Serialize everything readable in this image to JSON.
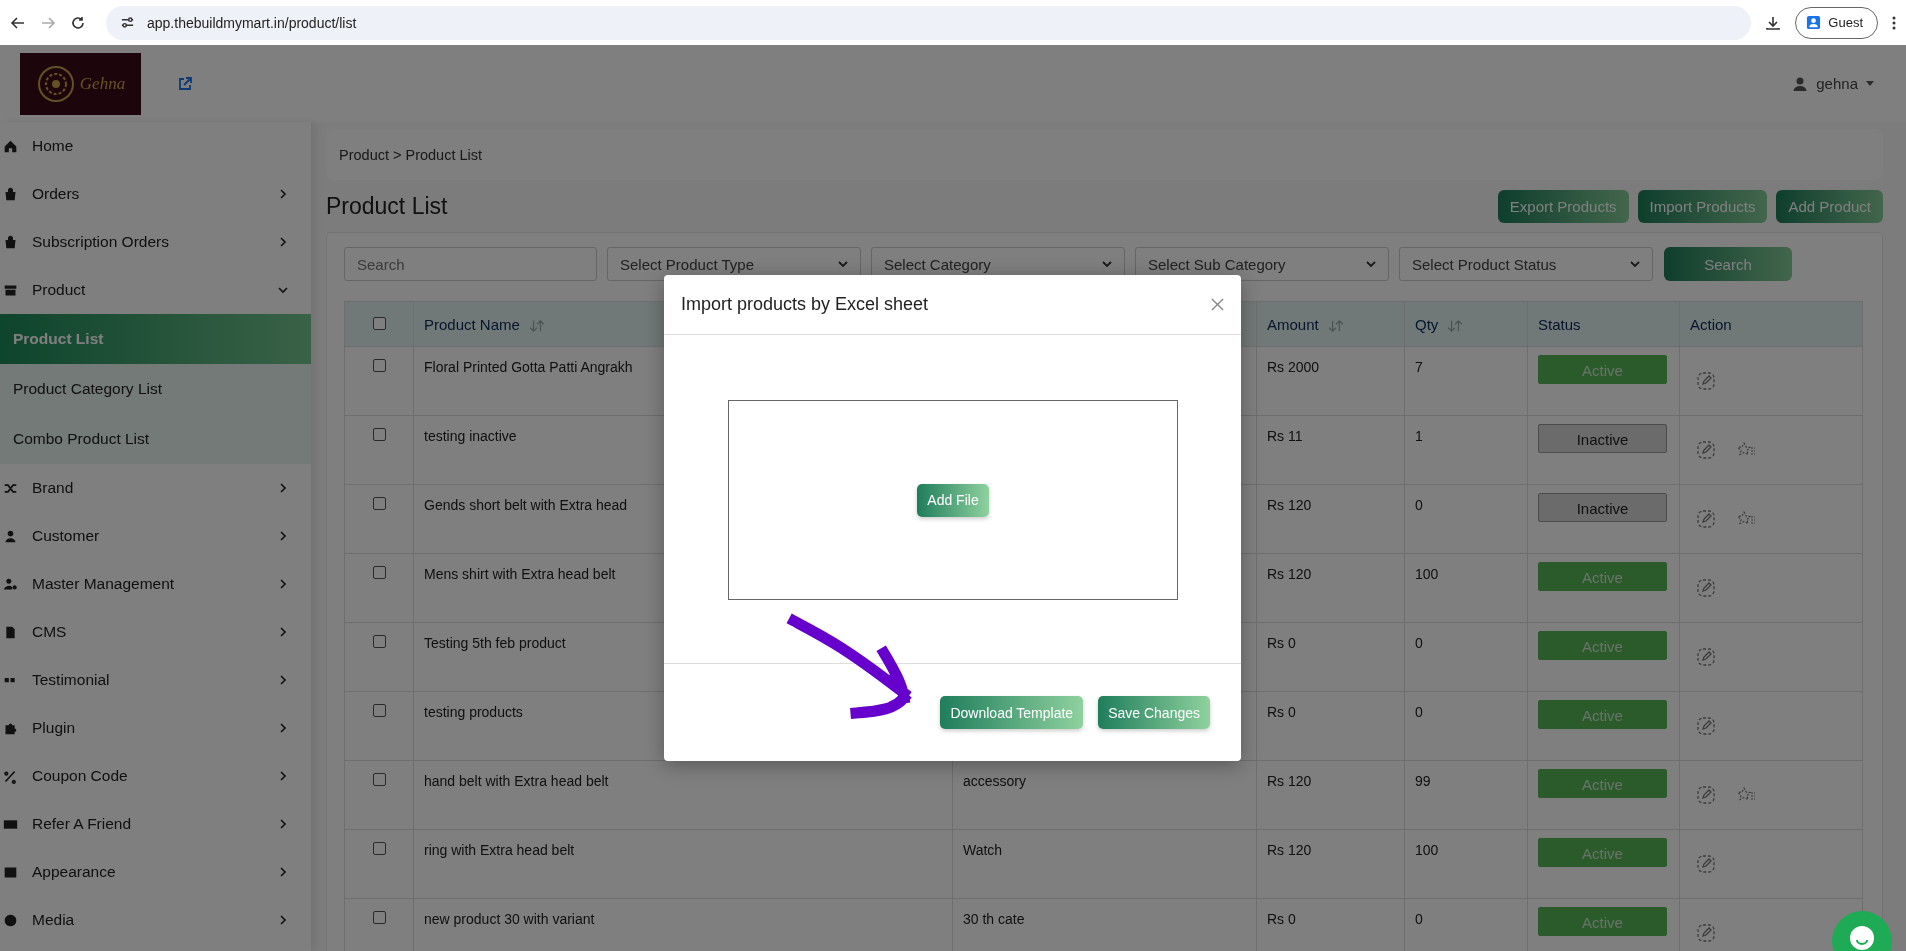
{
  "browser": {
    "url": "app.thebuildmymart.in/product/list",
    "profile": "Guest"
  },
  "header": {
    "logo_text": "Gehna",
    "user": "gehna"
  },
  "sidebar": {
    "items": [
      {
        "label": "Home",
        "kind": "link",
        "selected": false
      },
      {
        "label": "Orders",
        "kind": "group",
        "selected": false,
        "expanded": false
      },
      {
        "label": "Subscription Orders",
        "kind": "group",
        "selected": false,
        "expanded": false
      },
      {
        "label": "Product",
        "kind": "group",
        "selected": false,
        "expanded": true,
        "children": [
          {
            "label": "Product List",
            "selected": true
          },
          {
            "label": "Product Category List",
            "selected": false
          },
          {
            "label": "Combo Product List",
            "selected": false
          }
        ]
      },
      {
        "label": "Brand",
        "kind": "group",
        "selected": false,
        "expanded": false
      },
      {
        "label": "Customer",
        "kind": "group",
        "selected": false,
        "expanded": false
      },
      {
        "label": "Master Management",
        "kind": "group",
        "selected": false,
        "expanded": false
      },
      {
        "label": "CMS",
        "kind": "group",
        "selected": false,
        "expanded": false
      },
      {
        "label": "Testimonial",
        "kind": "group",
        "selected": false,
        "expanded": false
      },
      {
        "label": "Plugin",
        "kind": "group",
        "selected": false,
        "expanded": false
      },
      {
        "label": "Coupon Code",
        "kind": "group",
        "selected": false,
        "expanded": false
      },
      {
        "label": "Refer A Friend",
        "kind": "group",
        "selected": false,
        "expanded": false
      },
      {
        "label": "Appearance",
        "kind": "group",
        "selected": false,
        "expanded": false
      },
      {
        "label": "Media",
        "kind": "group",
        "selected": false,
        "expanded": false
      }
    ]
  },
  "breadcrumb": "Product > Product List",
  "page_title": "Product List",
  "actions": [
    "Export Products",
    "Import Products",
    "Add Product"
  ],
  "filters": {
    "search_placeholder": "Search",
    "selects": [
      "Select Product Type",
      "Select Category",
      "Select Sub Category",
      "Select Product Status"
    ],
    "button": "Search"
  },
  "table": {
    "select_all_checked": false,
    "columns": [
      {
        "label": "Product Name",
        "sortable": true
      },
      {
        "label": "Amount",
        "sortable": true
      },
      {
        "label": "Qty",
        "sortable": true
      },
      {
        "label": "Status",
        "sortable": false
      },
      {
        "label": "Action",
        "sortable": false
      }
    ],
    "rows": [
      {
        "checked": false,
        "name": "Floral Printed Gotta Patti Angrakh",
        "amount": "Rs 2000",
        "qty": "7",
        "status": "Active",
        "active": true,
        "extra_action": false
      },
      {
        "checked": false,
        "name": "testing inactive",
        "amount": "Rs 11",
        "qty": "1",
        "status": "Inactive",
        "active": false,
        "extra_action": true
      },
      {
        "checked": false,
        "name": "Gends short belt with Extra head",
        "amount": "Rs 120",
        "qty": "0",
        "status": "Inactive",
        "active": false,
        "extra_action": true
      },
      {
        "checked": false,
        "name": "Mens shirt with Extra head belt",
        "amount": "Rs 120",
        "qty": "100",
        "status": "Active",
        "active": true,
        "extra_action": false
      },
      {
        "checked": false,
        "name": "Testing 5th feb product",
        "amount": "Rs 0",
        "qty": "0",
        "status": "Active",
        "active": true,
        "extra_action": false
      },
      {
        "checked": false,
        "name": "testing products",
        "amount": "Rs 0",
        "qty": "0",
        "status": "Active",
        "active": true,
        "extra_action": false
      },
      {
        "checked": false,
        "name": "hand belt with Extra head belt",
        "column_3": "accessory",
        "amount": "Rs 120",
        "qty": "99",
        "status": "Active",
        "active": true,
        "extra_action": true
      },
      {
        "checked": false,
        "name": "ring with Extra head belt",
        "column_3": "Watch",
        "amount": "Rs 120",
        "qty": "100",
        "status": "Active",
        "active": true,
        "extra_action": false
      },
      {
        "checked": false,
        "name": "new product 30 with variant",
        "column_3": "30 th cate",
        "amount": "Rs 0",
        "qty": "0",
        "status": "Active",
        "active": true,
        "extra_action": false
      }
    ]
  },
  "modal": {
    "title": "Import products by Excel sheet",
    "add_file": "Add File",
    "buttons": [
      "Download Template",
      "Save Changes"
    ]
  }
}
